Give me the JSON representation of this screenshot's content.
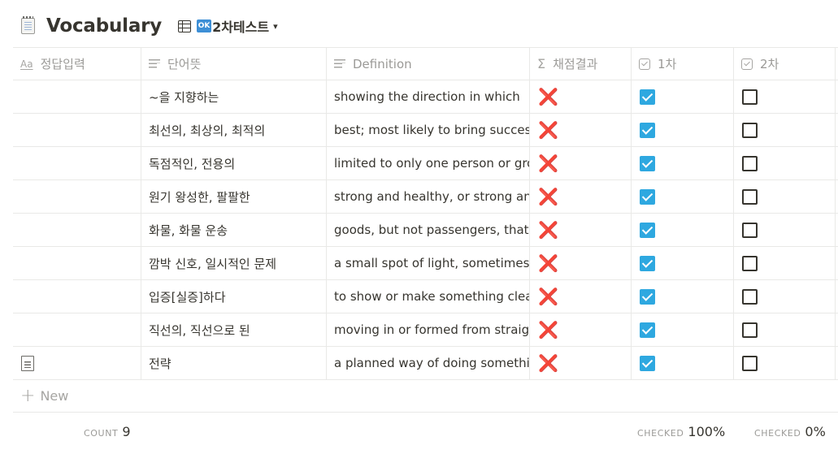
{
  "page": {
    "title": "Vocabulary",
    "icon": "notebook-icon"
  },
  "view": {
    "icon": "table-icon",
    "badge": "OK",
    "label": "2차테스트",
    "chevron": "chevron-down-icon"
  },
  "columns": [
    {
      "label": "정답입력",
      "icon": "title-property-icon",
      "icon_text": "Aa"
    },
    {
      "label": "단어뜻",
      "icon": "text-property-icon"
    },
    {
      "label": "Definition",
      "icon": "text-property-icon"
    },
    {
      "label": "채점결과",
      "icon": "formula-sigma-icon",
      "icon_text": "Σ"
    },
    {
      "label": "1차",
      "icon": "checkbox-property-icon"
    },
    {
      "label": "2차",
      "icon": "checkbox-property-icon"
    }
  ],
  "rows": [
    {
      "answer": "",
      "meaning": "~을 지향하는",
      "definition": "showing the direction in which",
      "result": "❌",
      "first": true,
      "second": false
    },
    {
      "answer": "",
      "meaning": "최선의, 최상의, 최적의",
      "definition": "best; most likely to bring success",
      "result": "❌",
      "first": true,
      "second": false
    },
    {
      "answer": "",
      "meaning": "독점적인, 전용의",
      "definition": "limited to only one person or group",
      "result": "❌",
      "first": true,
      "second": false
    },
    {
      "answer": "",
      "meaning": "원기 왕성한, 팔팔한",
      "definition": "strong and healthy, or strong and",
      "result": "❌",
      "first": true,
      "second": false
    },
    {
      "answer": "",
      "meaning": "화물, 화물 운송",
      "definition": "goods, but not passengers, that",
      "result": "❌",
      "first": true,
      "second": false
    },
    {
      "answer": "",
      "meaning": "깜박 신호, 일시적인 문제",
      "definition": "a small spot of light, sometimes",
      "result": "❌",
      "first": true,
      "second": false
    },
    {
      "answer": "",
      "meaning": "입증[실증]하다",
      "definition": "to show or make something clear",
      "result": "❌",
      "first": true,
      "second": false
    },
    {
      "answer": "",
      "meaning": "직선의, 직선으로 된",
      "definition": "moving in or formed from straight",
      "result": "❌",
      "first": true,
      "second": false
    },
    {
      "answer": "",
      "meaning": "전략",
      "definition": "a planned way of doing something",
      "result": "❌",
      "first": true,
      "second": false,
      "has_page_icon": true
    }
  ],
  "new_row": {
    "label": "New",
    "icon": "plus-icon"
  },
  "footer": {
    "count_label": "COUNT",
    "count_value": "9",
    "checked1_label": "CHECKED",
    "checked1_value": "100%",
    "checked2_label": "CHECKED",
    "checked2_value": "0%"
  }
}
